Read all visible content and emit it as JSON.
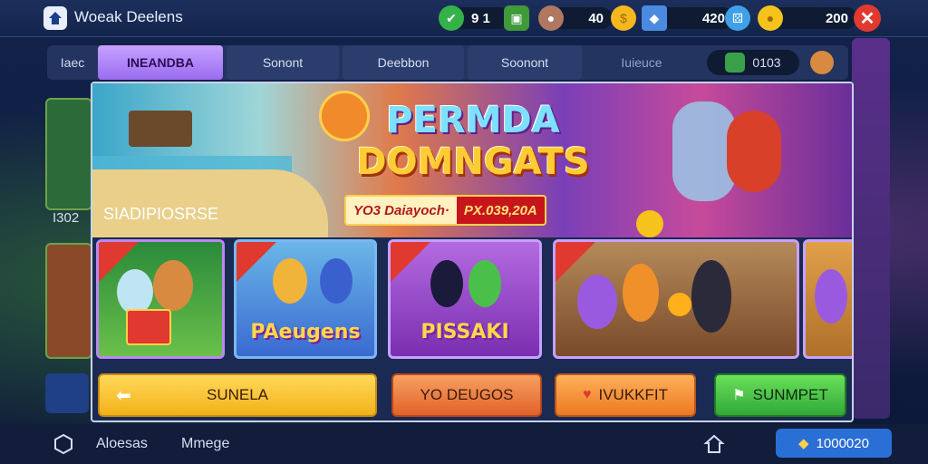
{
  "app": {
    "title": "Woeak Deelens"
  },
  "resources": [
    {
      "icon": "shield-icon",
      "value": "9 1",
      "color": "#35b24a"
    },
    {
      "icon": "treasure-chest-icon",
      "value": "",
      "color": "#3f9a3a"
    },
    {
      "icon": "boulder-icon",
      "value": "40",
      "color": "#b07860"
    },
    {
      "icon": "coin-icon",
      "value": "",
      "color": "#f4b81f"
    },
    {
      "icon": "gem-crate-icon",
      "value": "420",
      "color": "#4a8ae0"
    },
    {
      "icon": "dice-icon",
      "value": "",
      "color": "#3fa0e8"
    },
    {
      "icon": "gold-coin-icon",
      "value": "200",
      "color": "#f6c21c"
    }
  ],
  "tabs": [
    {
      "label": "Iaec",
      "active": false
    },
    {
      "label": "INEANDBA",
      "active": true
    },
    {
      "label": "Sonont",
      "active": false
    },
    {
      "label": "Deebbon",
      "active": false
    },
    {
      "label": "Soonont",
      "active": false
    },
    {
      "label": "Iuieuce",
      "active": false
    }
  ],
  "tab_balance": "0103",
  "side_label": "I302",
  "hero": {
    "title_line1": "PERMDA",
    "title_line2": "DOMNGATS",
    "promo_left": "YO3 Daiayoch·",
    "promo_right": "PX.039,20A"
  },
  "section_title": "SIADIPIOSRSE",
  "cards": [
    {
      "badge": "",
      "title": ""
    },
    {
      "badge": "",
      "title": "PAeugens"
    },
    {
      "badge": "",
      "title": "PISSAKI"
    },
    {
      "badge": "",
      "title": ""
    },
    {
      "badge": "",
      "title": ""
    }
  ],
  "buttons": [
    {
      "label": "SUNELA",
      "color": "#f9c530",
      "icon": "arrow-left-icon"
    },
    {
      "label": "YO DEUGOS",
      "color": "#f2873a",
      "icon": ""
    },
    {
      "label": "IVUKKFIT",
      "color": "#f49a36",
      "icon": "heart-icon"
    },
    {
      "label": "SUNMPET",
      "color": "#45c04a",
      "icon": "flag-icon"
    }
  ],
  "bottom": {
    "left_label": "Aloesas",
    "mid_label": "Mmege",
    "gem_value": "1000020"
  }
}
